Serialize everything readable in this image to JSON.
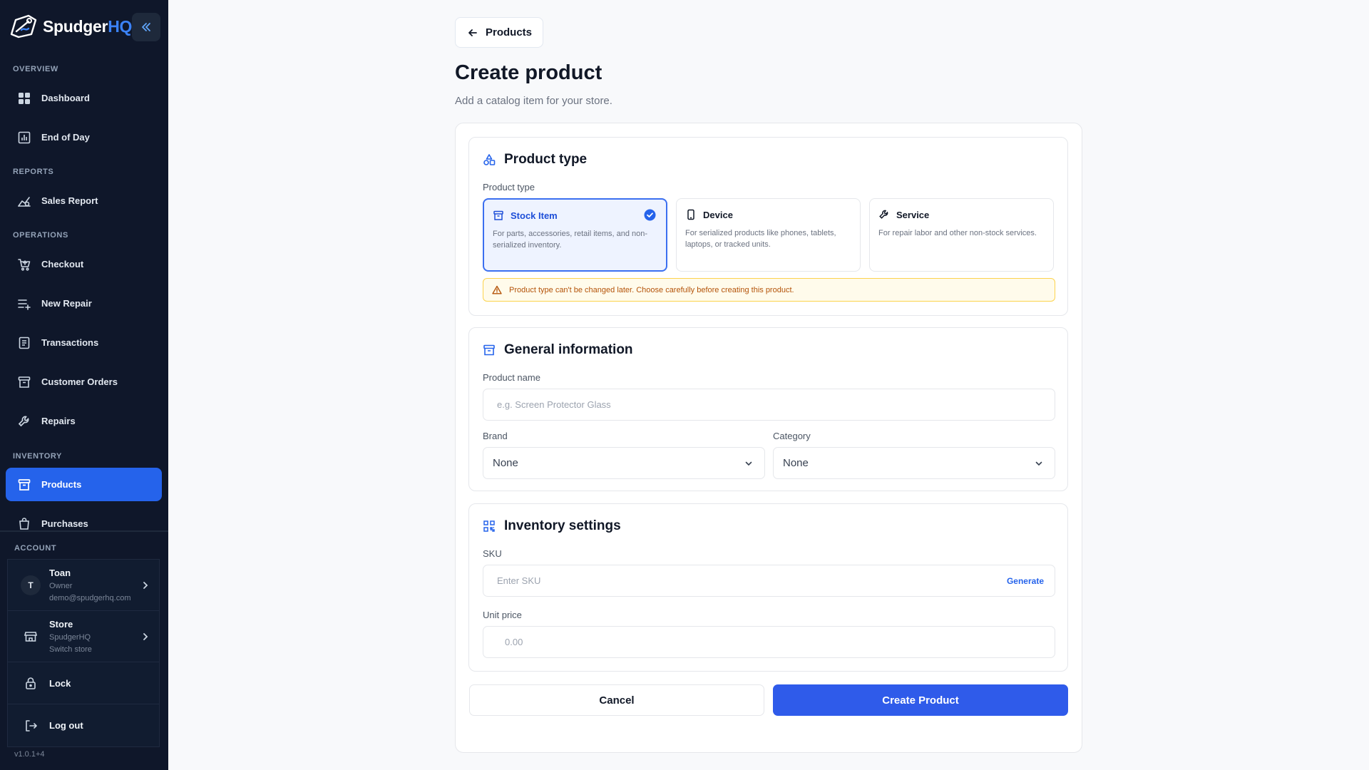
{
  "brand": {
    "name_main": "Spudger",
    "name_accent": "HQ"
  },
  "sidebar": {
    "sections": {
      "overview": "OVERVIEW",
      "reports": "REPORTS",
      "operations": "OPERATIONS",
      "inventory": "INVENTORY",
      "account": "ACCOUNT"
    },
    "items": {
      "dashboard": "Dashboard",
      "end_of_day": "End of Day",
      "sales_report": "Sales Report",
      "checkout": "Checkout",
      "new_repair": "New Repair",
      "transactions": "Transactions",
      "customer_orders": "Customer Orders",
      "repairs": "Repairs",
      "products": "Products",
      "purchases": "Purchases"
    },
    "active_item": "products"
  },
  "account": {
    "user": {
      "initial": "T",
      "name": "Toan",
      "role": "Owner",
      "email": "demo@spudgerhq.com"
    },
    "store": {
      "title": "Store",
      "name": "SpudgerHQ",
      "action": "Switch store"
    },
    "lock_label": "Lock",
    "logout_label": "Log out"
  },
  "version": "v1.0.1+4",
  "page": {
    "back_label": "Products",
    "title": "Create product",
    "subtitle": "Add a catalog item for your store."
  },
  "product_type": {
    "heading": "Product type",
    "field_label": "Product type",
    "options": [
      {
        "name": "Stock Item",
        "description": "For parts, accessories, retail items, and non-serialized inventory.",
        "selected": true
      },
      {
        "name": "Device",
        "description": "For serialized products like phones, tablets, laptops, or tracked units.",
        "selected": false
      },
      {
        "name": "Service",
        "description": "For repair labor and other non-stock services.",
        "selected": false
      }
    ],
    "warning": "Product type can't be changed later. Choose carefully before creating this product."
  },
  "general": {
    "heading": "General information",
    "product_name_label": "Product name",
    "product_name_placeholder": "e.g. Screen Protector Glass",
    "brand_label": "Brand",
    "brand_value": "None",
    "category_label": "Category",
    "category_value": "None"
  },
  "inventory": {
    "heading": "Inventory settings",
    "sku_label": "SKU",
    "sku_placeholder": "Enter SKU",
    "generate_label": "Generate",
    "unit_price_label": "Unit price",
    "unit_price_placeholder": "0.00"
  },
  "actions": {
    "cancel": "Cancel",
    "create": "Create Product"
  },
  "colors": {
    "accent": "#2f5bea",
    "sidebar_bg": "#0f172a",
    "active_nav": "#2563eb",
    "warning_text": "#b45309",
    "warning_bg": "#fffbeb"
  }
}
